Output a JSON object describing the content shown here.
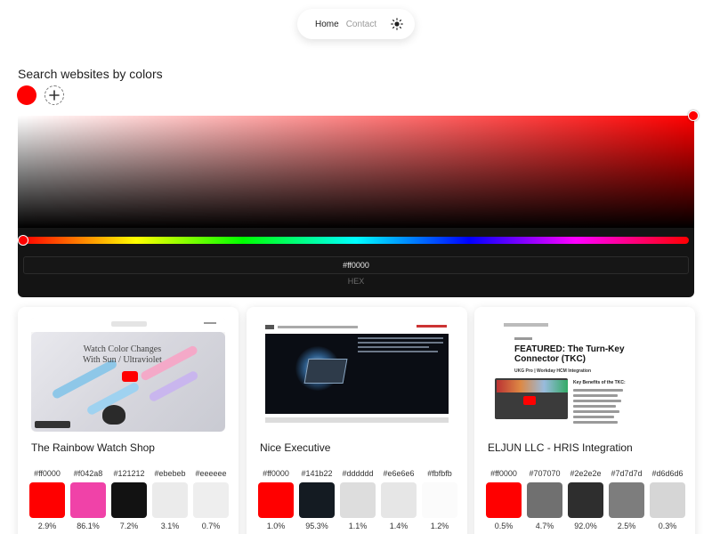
{
  "nav": {
    "home": "Home",
    "contact": "Contact",
    "theme_icon": "sun-icon"
  },
  "search": {
    "heading": "Search websites by colors",
    "selected_colors": [
      "#ff0000"
    ],
    "add_icon": "plus-icon"
  },
  "picker": {
    "hex_value": "#ff0000",
    "hex_label": "HEX",
    "hue_color": "#ff0000"
  },
  "cards": [
    {
      "title": "The Rainbow Watch Shop",
      "screenshot": {
        "header": "Rainbow Watch",
        "video_text": "Watch Color Changes\nWith Sun / Ultraviolet"
      },
      "palette": [
        {
          "hex": "#ff0000",
          "pct": "2.9%"
        },
        {
          "hex": "#f042a8",
          "pct": "86.1%"
        },
        {
          "hex": "#121212",
          "pct": "7.2%"
        },
        {
          "hex": "#ebebeb",
          "pct": "3.1%"
        },
        {
          "hex": "#eeeeee",
          "pct": "0.7%"
        }
      ]
    },
    {
      "title": "Nice Executive",
      "screenshot": {},
      "palette": [
        {
          "hex": "#ff0000",
          "pct": "1.0%"
        },
        {
          "hex": "#141b22",
          "pct": "95.3%"
        },
        {
          "hex": "#dddddd",
          "pct": "1.1%"
        },
        {
          "hex": "#e6e6e6",
          "pct": "1.4%"
        },
        {
          "hex": "#fbfbfb",
          "pct": "1.2%"
        }
      ]
    },
    {
      "title": "ELJUN LLC - HRIS Integration",
      "screenshot": {
        "headline": "FEATURED: The Turn-Key Connector (TKC)",
        "sub": "UKG Pro | Workday HCM Integration",
        "benefits": "Key Benefits of the TKC:"
      },
      "palette": [
        {
          "hex": "#ff0000",
          "pct": "0.5%"
        },
        {
          "hex": "#707070",
          "pct": "4.7%"
        },
        {
          "hex": "#2e2e2e",
          "pct": "92.0%"
        },
        {
          "hex": "#7d7d7d",
          "pct": "2.5%"
        },
        {
          "hex": "#d6d6d6",
          "pct": "0.3%"
        }
      ]
    }
  ]
}
